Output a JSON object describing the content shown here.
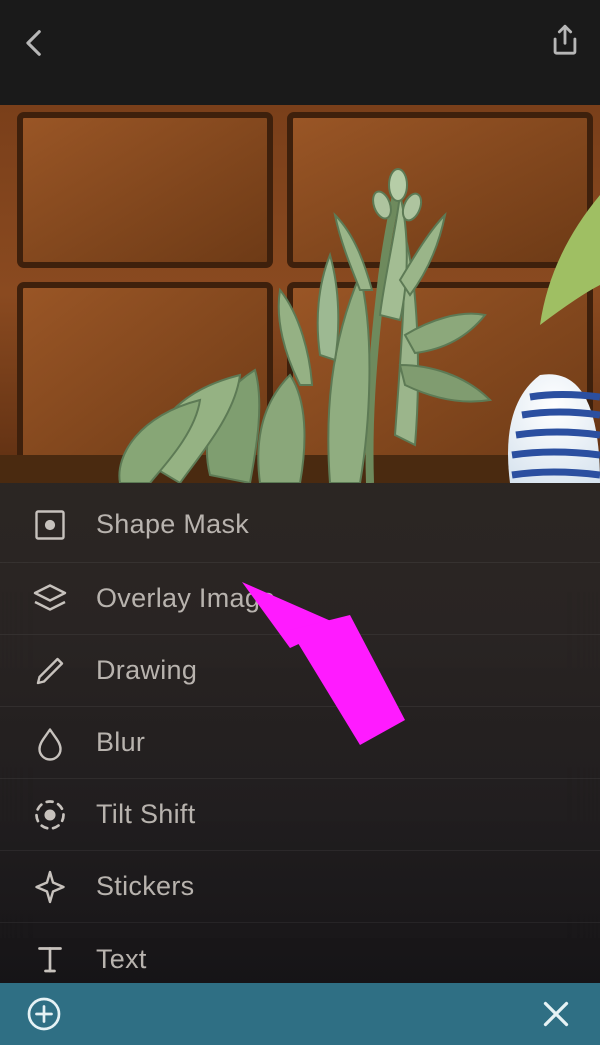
{
  "menu": {
    "items": [
      {
        "id": "shape-mask",
        "label": "Shape Mask",
        "icon": "shape-mask-icon"
      },
      {
        "id": "overlay-image",
        "label": "Overlay Image",
        "icon": "layers-icon"
      },
      {
        "id": "drawing",
        "label": "Drawing",
        "icon": "pencil-icon"
      },
      {
        "id": "blur",
        "label": "Blur",
        "icon": "droplet-icon"
      },
      {
        "id": "tilt-shift",
        "label": "Tilt Shift",
        "icon": "tilt-shift-icon"
      },
      {
        "id": "stickers",
        "label": "Stickers",
        "icon": "sparkle-icon"
      },
      {
        "id": "text",
        "label": "Text",
        "icon": "text-icon"
      }
    ]
  },
  "colors": {
    "bottombar": "#2f6f84",
    "annotation_arrow": "#ff1bff"
  },
  "annotation": {
    "points_to": "overlay-image"
  }
}
